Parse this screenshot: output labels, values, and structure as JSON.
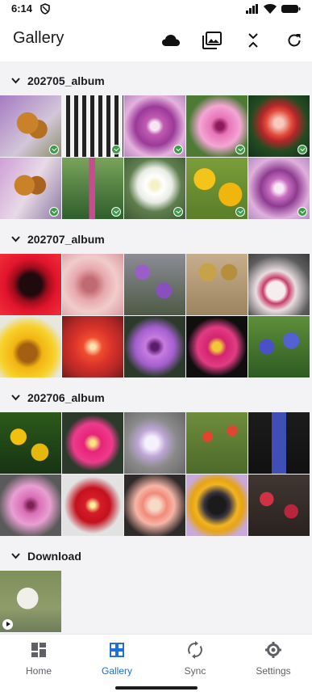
{
  "status": {
    "time": "6:14"
  },
  "app": {
    "title": "Gallery",
    "actions": [
      "cloud-icon",
      "photo-library-icon",
      "collapse-icon",
      "refresh-icon"
    ]
  },
  "albums": [
    {
      "name": "202705_album",
      "photos": [
        {
          "desc": "butterfly",
          "synced": true
        },
        {
          "desc": "black-white-pattern",
          "synced": true
        },
        {
          "desc": "purple-flower",
          "synced": true
        },
        {
          "desc": "pink-flower",
          "synced": true
        },
        {
          "desc": "red-flower",
          "synced": true
        },
        {
          "desc": "butterfly-2",
          "synced": true
        },
        {
          "desc": "green-pink-spike",
          "synced": true
        },
        {
          "desc": "white-flower",
          "synced": true
        },
        {
          "desc": "yellow-flowers",
          "synced": true
        },
        {
          "desc": "purple-flower-2",
          "synced": true
        }
      ]
    },
    {
      "name": "202707_album",
      "photos": [
        {
          "desc": "red-dark-center",
          "synced": false
        },
        {
          "desc": "pink-rose",
          "synced": false
        },
        {
          "desc": "purple-sprigs",
          "synced": false
        },
        {
          "desc": "dried-pods",
          "synced": false
        },
        {
          "desc": "white-pink-rose",
          "synced": false
        },
        {
          "desc": "sunflower-bee",
          "synced": false
        },
        {
          "desc": "red-lily",
          "synced": false
        },
        {
          "desc": "purple-daisy",
          "synced": false
        },
        {
          "desc": "magenta-zinnia",
          "synced": false
        },
        {
          "desc": "blue-flowers",
          "synced": false
        }
      ]
    },
    {
      "name": "202706_album",
      "photos": [
        {
          "desc": "yellow-shrub",
          "synced": false
        },
        {
          "desc": "magenta-daisy",
          "synced": false
        },
        {
          "desc": "lilac-blooms",
          "synced": false
        },
        {
          "desc": "red-poppies",
          "synced": false
        },
        {
          "desc": "blue-grape-hyacinth",
          "synced": false
        },
        {
          "desc": "pink-petunia",
          "synced": false
        },
        {
          "desc": "red-hibiscus",
          "synced": false
        },
        {
          "desc": "pink-zinnia",
          "synced": false
        },
        {
          "desc": "dark-sunflower",
          "synced": false
        },
        {
          "desc": "red-echinacea",
          "synced": false
        }
      ]
    },
    {
      "name": "Download",
      "photos": [
        {
          "desc": "video-thumbnail",
          "synced": false,
          "video": true
        }
      ]
    }
  ],
  "nav": {
    "items": [
      {
        "label": "Home",
        "icon": "home-grid-icon",
        "active": false
      },
      {
        "label": "Gallery",
        "icon": "gallery-grid-icon",
        "active": true
      },
      {
        "label": "Sync",
        "icon": "sync-icon",
        "active": false
      },
      {
        "label": "Settings",
        "icon": "settings-gear-icon",
        "active": false
      }
    ]
  },
  "colors": {
    "accent": "#1e6fe0",
    "sync_badge": "#3f9a4c"
  }
}
